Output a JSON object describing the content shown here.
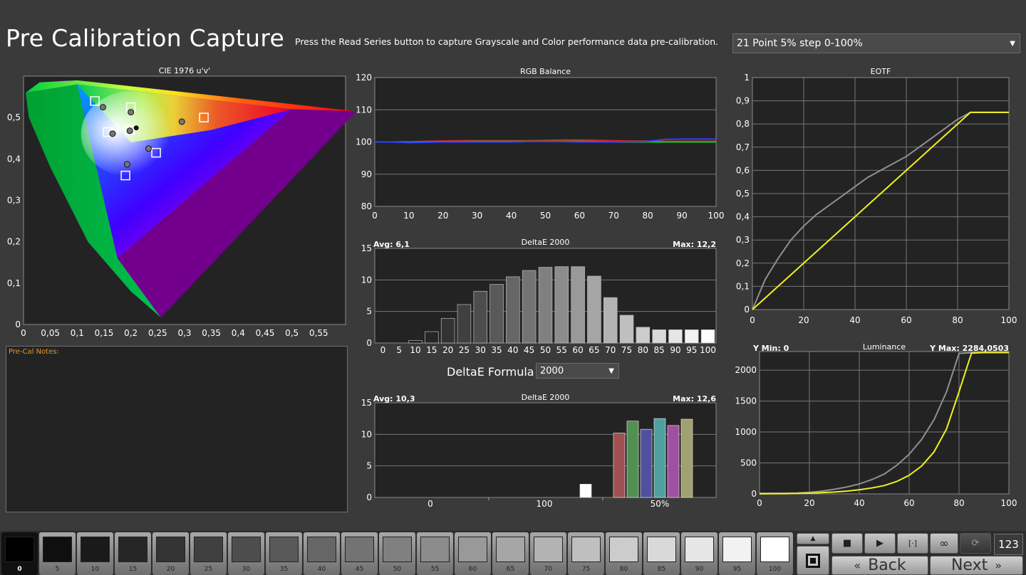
{
  "page": {
    "title": "Pre Calibration Capture",
    "instructions": "Press the Read Series button to capture Grayscale and Color performance data pre-calibration.",
    "series_select": "21 Point 5% step 0-100%"
  },
  "notes": {
    "label": "Pre-Cal Notes:"
  },
  "formula": {
    "label": "DeltaE Formula",
    "value": "2000"
  },
  "colors": {
    "background": "#3a3a3a",
    "plot_bg": "#232323",
    "yellow": "#f0f020",
    "gray_line": "#909090",
    "notes_label": "#e0982b"
  },
  "chart_data": [
    {
      "type": "scatter",
      "title": "CIE 1976 u'v'",
      "x_ticks": [
        "0",
        "0,05",
        "0,1",
        "0,15",
        "0,2",
        "0,25",
        "0,3",
        "0,35",
        "0,4",
        "0,45",
        "0,5",
        "0,55"
      ],
      "y_ticks": [
        "0",
        "0,1",
        "0,2",
        "0,3",
        "0,4",
        "0,5"
      ],
      "xlim": [
        0,
        0.6
      ],
      "ylim": [
        0,
        0.6
      ],
      "targets": [
        [
          0.133,
          0.54
        ],
        [
          0.2,
          0.525
        ],
        [
          0.157,
          0.465
        ],
        [
          0.198,
          0.47
        ],
        [
          0.247,
          0.415
        ],
        [
          0.19,
          0.36
        ],
        [
          0.336,
          0.5
        ]
      ],
      "measured": [
        [
          0.148,
          0.525
        ],
        [
          0.2,
          0.513
        ],
        [
          0.166,
          0.461
        ],
        [
          0.198,
          0.468
        ],
        [
          0.233,
          0.425
        ],
        [
          0.193,
          0.387
        ],
        [
          0.295,
          0.49
        ]
      ],
      "white_point_measured": [
        0.21,
        0.475
      ]
    },
    {
      "type": "line",
      "title": "RGB Balance",
      "x": [
        0,
        5,
        10,
        15,
        20,
        25,
        30,
        35,
        40,
        45,
        50,
        55,
        60,
        65,
        70,
        75,
        80,
        85,
        90,
        95,
        100
      ],
      "x_ticks": [
        "0",
        "10",
        "20",
        "30",
        "40",
        "50",
        "60",
        "70",
        "80",
        "90",
        "100"
      ],
      "y_ticks": [
        "80",
        "90",
        "100",
        "110",
        "120"
      ],
      "ylim": [
        80,
        120
      ],
      "series": [
        {
          "color": "#e02020",
          "values": [
            100,
            100,
            100,
            100.2,
            100.3,
            100.4,
            100.4,
            100.4,
            100.4,
            100.4,
            100.5,
            100.6,
            100.6,
            100.5,
            100.4,
            100.3,
            100.3,
            100.2,
            100.2,
            100.2,
            100.2
          ]
        },
        {
          "color": "#20c020",
          "values": [
            100,
            100,
            100,
            100,
            100.1,
            100.1,
            100.2,
            100.2,
            100.2,
            100.2,
            100.2,
            100.2,
            100.2,
            100.1,
            100,
            100,
            100,
            100,
            100,
            100,
            100
          ]
        },
        {
          "color": "#3040ff",
          "values": [
            100,
            100,
            99.8,
            99.9,
            100,
            100,
            100,
            100,
            100,
            100.1,
            100.1,
            100.1,
            100,
            100,
            100,
            100.1,
            100.2,
            100.8,
            100.9,
            100.9,
            100.9
          ]
        }
      ]
    },
    {
      "type": "bar",
      "title": "DeltaE 2000",
      "avg_label": "Avg: 6,1",
      "max_label": "Max: 12,2",
      "categories": [
        "0",
        "5",
        "10",
        "15",
        "20",
        "25",
        "30",
        "35",
        "40",
        "45",
        "50",
        "55",
        "60",
        "65",
        "70",
        "75",
        "80",
        "85",
        "90",
        "95",
        "100"
      ],
      "values": [
        0,
        0,
        0.4,
        1.8,
        3.9,
        6.1,
        8.2,
        9.3,
        10.5,
        11.5,
        12,
        12.1,
        12.1,
        10.6,
        7.2,
        4.4,
        2.5,
        2.1,
        2.1,
        2.1,
        2.1
      ],
      "y_ticks": [
        "0",
        "5",
        "10",
        "15"
      ],
      "ylim": [
        0,
        15
      ]
    },
    {
      "type": "bar",
      "title": "DeltaE 2000",
      "avg_label": "Avg: 10,3",
      "max_label": "Max: 12,6",
      "group_labels": [
        "0",
        "100",
        "50%"
      ],
      "values": [
        2.1,
        10.2,
        12.1,
        10.8,
        12.5,
        11.4,
        12.4
      ],
      "bar_colors": [
        "#ffffff",
        "#a05050",
        "#509050",
        "#5050a0",
        "#50a0a0",
        "#a050a0",
        "#a0a070"
      ],
      "y_ticks": [
        "0",
        "5",
        "10",
        "15"
      ],
      "ylim": [
        0,
        15
      ]
    },
    {
      "type": "line",
      "title": "EOTF",
      "x": [
        0,
        5,
        10,
        15,
        20,
        25,
        30,
        35,
        40,
        45,
        50,
        55,
        60,
        65,
        70,
        75,
        80,
        85,
        90,
        95,
        100
      ],
      "x_ticks": [
        "0",
        "20",
        "40",
        "60",
        "80",
        "100"
      ],
      "y_ticks": [
        "0",
        "0,1",
        "0,2",
        "0,3",
        "0,4",
        "0,5",
        "0,6",
        "0,7",
        "0,8",
        "0,9",
        "1"
      ],
      "ylim": [
        0,
        1
      ],
      "series": [
        {
          "color": "#909090",
          "values": [
            0,
            0.13,
            0.22,
            0.3,
            0.36,
            0.41,
            0.45,
            0.49,
            0.53,
            0.57,
            0.6,
            0.63,
            0.66,
            0.7,
            0.74,
            0.78,
            0.82,
            0.85,
            0.85,
            0.85,
            0.85
          ]
        },
        {
          "color": "#f0f020",
          "values": [
            0,
            0.05,
            0.1,
            0.15,
            0.2,
            0.25,
            0.3,
            0.35,
            0.4,
            0.45,
            0.5,
            0.55,
            0.6,
            0.65,
            0.7,
            0.75,
            0.8,
            0.85,
            0.85,
            0.85,
            0.85
          ]
        }
      ]
    },
    {
      "type": "line",
      "title": "Luminance",
      "y_min_label": "Y Min: 0",
      "y_max_label": "Y Max: 2284,0503",
      "x": [
        0,
        5,
        10,
        15,
        20,
        25,
        30,
        35,
        40,
        45,
        50,
        55,
        60,
        65,
        70,
        75,
        80,
        85,
        90,
        95,
        100
      ],
      "x_ticks": [
        "0",
        "20",
        "40",
        "60",
        "80",
        "100"
      ],
      "y_ticks": [
        "0",
        "500",
        "1000",
        "1500",
        "2000"
      ],
      "ylim": [
        0,
        2300
      ],
      "series": [
        {
          "color": "#909090",
          "values": [
            10,
            10,
            12,
            15,
            25,
            45,
            75,
            110,
            160,
            230,
            320,
            460,
            640,
            880,
            1200,
            1650,
            2270,
            2280,
            2284,
            2284,
            2284
          ]
        },
        {
          "color": "#f0f020",
          "values": [
            0,
            2,
            4,
            7,
            12,
            20,
            30,
            45,
            65,
            95,
            135,
            200,
            300,
            450,
            680,
            1050,
            1650,
            2275,
            2284,
            2284,
            2284
          ]
        }
      ]
    }
  ],
  "swatches": [
    {
      "label": "0",
      "color": "#000000",
      "active": true
    },
    {
      "label": "5",
      "color": "#0f0f0f"
    },
    {
      "label": "10",
      "color": "#1a1a1a"
    },
    {
      "label": "15",
      "color": "#262626"
    },
    {
      "label": "20",
      "color": "#333333"
    },
    {
      "label": "25",
      "color": "#404040"
    },
    {
      "label": "30",
      "color": "#4d4d4d"
    },
    {
      "label": "35",
      "color": "#595959"
    },
    {
      "label": "40",
      "color": "#666666"
    },
    {
      "label": "45",
      "color": "#737373"
    },
    {
      "label": "50",
      "color": "#808080"
    },
    {
      "label": "55",
      "color": "#8c8c8c"
    },
    {
      "label": "60",
      "color": "#999999"
    },
    {
      "label": "65",
      "color": "#a6a6a6"
    },
    {
      "label": "70",
      "color": "#b3b3b3"
    },
    {
      "label": "75",
      "color": "#bfbfbf"
    },
    {
      "label": "80",
      "color": "#cccccc"
    },
    {
      "label": "85",
      "color": "#d9d9d9"
    },
    {
      "label": "90",
      "color": "#e6e6e6"
    },
    {
      "label": "95",
      "color": "#f2f2f2"
    },
    {
      "label": "100",
      "color": "#ffffff"
    }
  ],
  "controls": {
    "back_label": "Back",
    "next_label": "Next",
    "counter": "123"
  }
}
